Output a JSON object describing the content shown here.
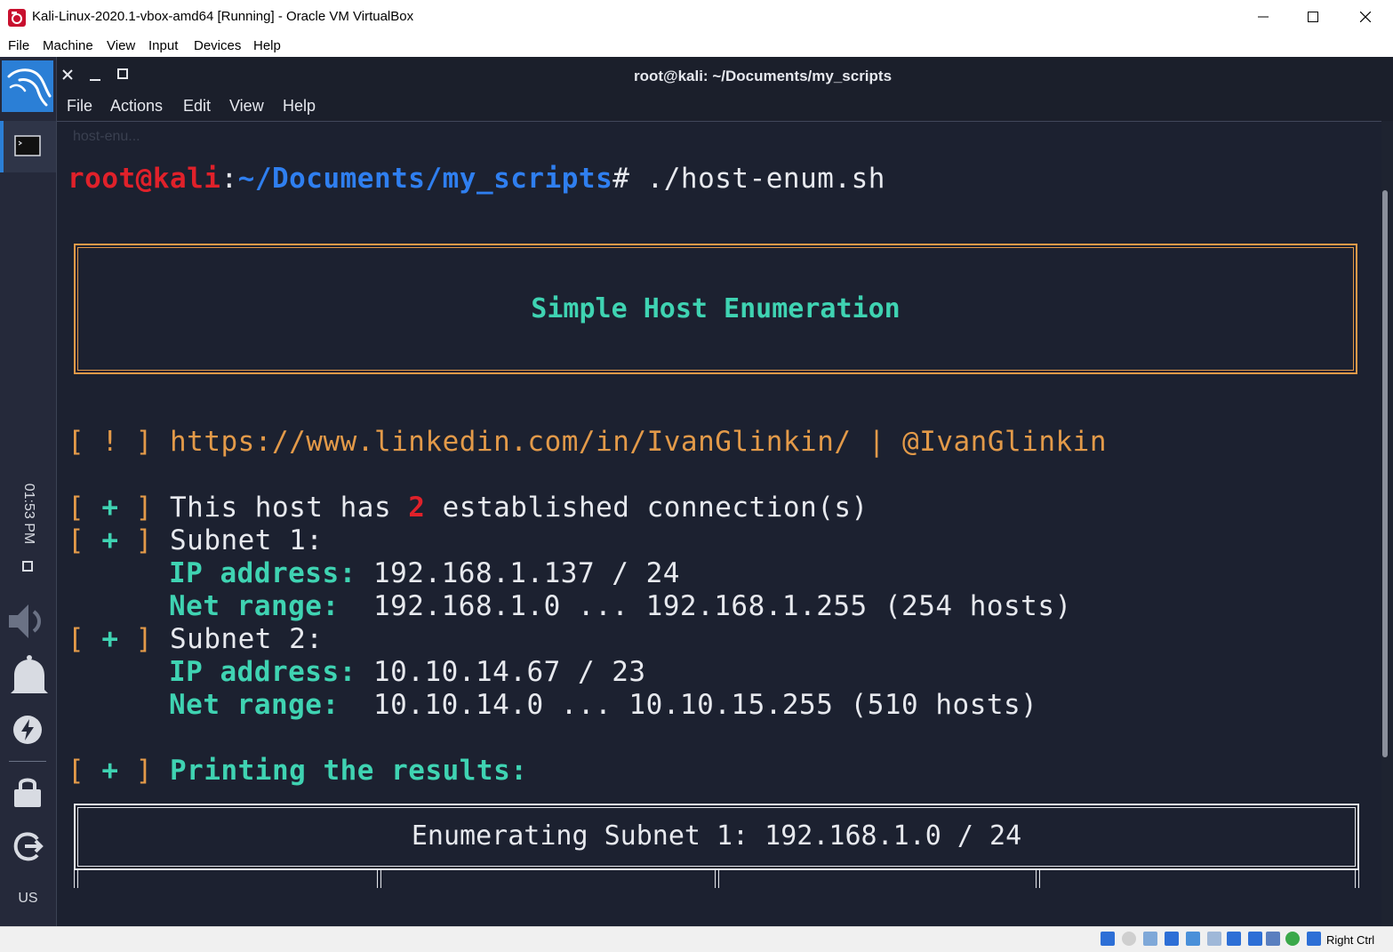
{
  "window": {
    "title": "Kali-Linux-2020.1-vbox-amd64 [Running] - Oracle VM VirtualBox",
    "menu": [
      "File",
      "Machine",
      "View",
      "Input",
      "Devices",
      "Help"
    ],
    "status_host_key": "Right Ctrl"
  },
  "panel": {
    "clock": "01:53 PM",
    "keyboard_layout": "US"
  },
  "terminal": {
    "title": "root@kali: ~/Documents/my_scripts",
    "menu": [
      "File",
      "Actions",
      "Edit",
      "View",
      "Help"
    ],
    "tab_ghost": "host-enu...",
    "prompt_user": "root@kali",
    "prompt_sep": ":",
    "prompt_path": "~/Documents/my_scripts",
    "prompt_hash": "#",
    "command": " ./host-enum.sh",
    "banner": "Simple Host Enumeration",
    "info_tag": "[ ! ]",
    "info_text": " https://www.linkedin.com/in/IvanGlinkin/ | @IvanGlinkin",
    "plus_tag_open": "[ ",
    "plus_sign": "+",
    "plus_tag_close": " ]",
    "conn_pre": " This host has ",
    "conn_count": "2",
    "conn_post": " established connection(s)",
    "subnet1_label": " Subnet 1:",
    "subnet1_ip_label": "IP address:",
    "subnet1_ip_value": " 192.168.1.137 / 24",
    "subnet1_range_label": "Net range:",
    "subnet1_range_value": "  192.168.1.0 ... 192.168.1.255 (254 hosts)",
    "subnet2_label": " Subnet 2:",
    "subnet2_ip_label": "IP address:",
    "subnet2_ip_value": " 10.10.14.67 / 23",
    "subnet2_range_label": "Net range:",
    "subnet2_range_value": "  10.10.14.0 ... 10.10.15.255 (510 hosts)",
    "printing": " Printing the results:",
    "enum_header": "Enumerating Subnet 1: 192.168.1.0 / 24"
  },
  "colors": {
    "prompt_user": "#e0212a",
    "prompt_path": "#2f7ff0",
    "accent_orange": "#e39a49",
    "accent_teal": "#3fd3b2",
    "terminal_bg": "#1c2130"
  }
}
